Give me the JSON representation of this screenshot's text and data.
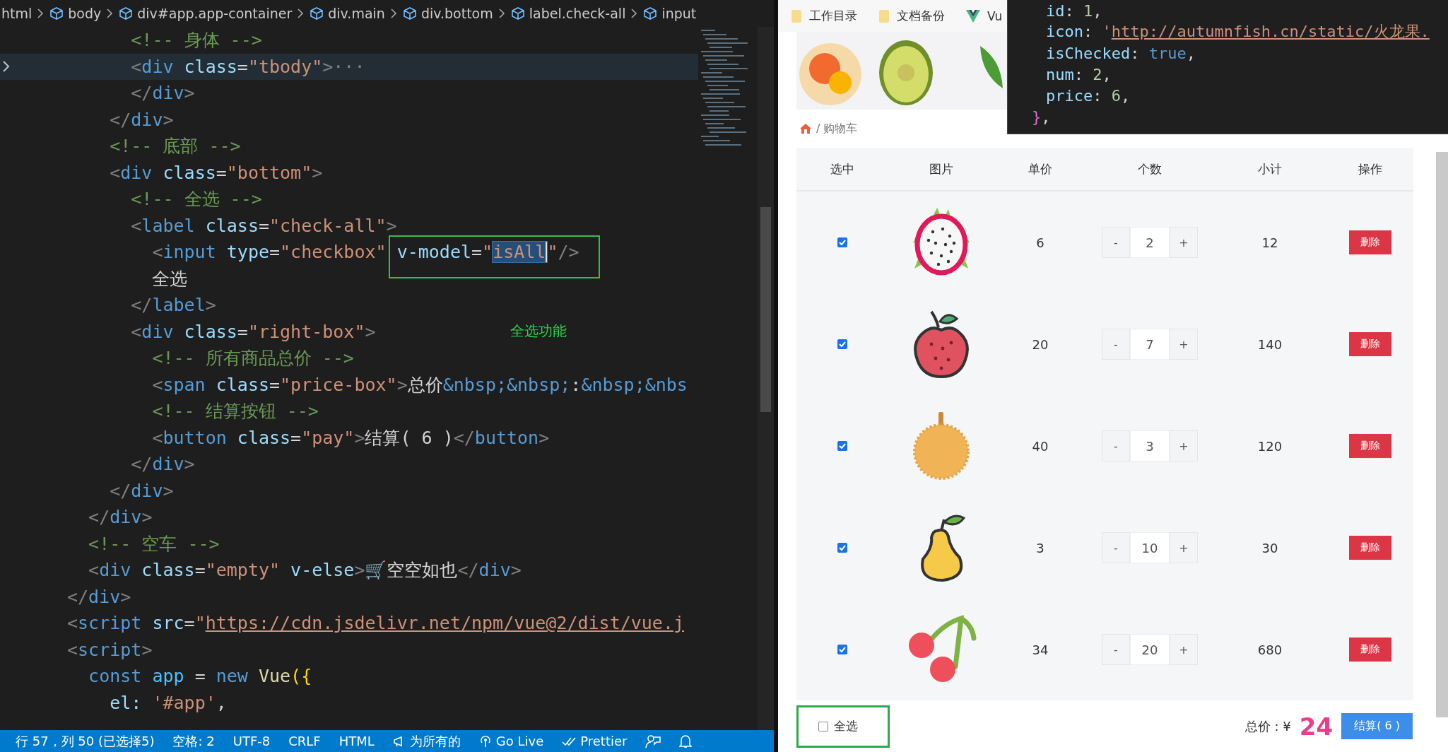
{
  "editor": {
    "breadcrumb": [
      "html",
      "body",
      "div#app.app-container",
      "div.main",
      "div.bottom",
      "label.check-all",
      "input"
    ],
    "lines": [
      {
        "folded": false,
        "tokens": [
          {
            "text": "      <!-- 身体 -->",
            "kind": "comment"
          }
        ]
      },
      {
        "folded": true,
        "tokens": [
          {
            "text": "      <",
            "kind": "punct"
          },
          {
            "text": "div",
            "kind": "tag"
          },
          {
            "text": " class",
            "kind": "attr"
          },
          {
            "text": "=",
            "kind": "plain"
          },
          {
            "text": "\"tbody\"",
            "kind": "string"
          },
          {
            "text": ">",
            "kind": "punct"
          },
          {
            "text": "···",
            "kind": "punct"
          }
        ]
      },
      {
        "folded": false,
        "tokens": [
          {
            "text": "      </",
            "kind": "punct"
          },
          {
            "text": "div",
            "kind": "tag"
          },
          {
            "text": ">",
            "kind": "punct"
          }
        ]
      },
      {
        "folded": false,
        "tokens": [
          {
            "text": "    </",
            "kind": "punct"
          },
          {
            "text": "div",
            "kind": "tag"
          },
          {
            "text": ">",
            "kind": "punct"
          }
        ]
      },
      {
        "folded": false,
        "tokens": [
          {
            "text": "    <!-- 底部 -->",
            "kind": "comment"
          }
        ]
      },
      {
        "folded": false,
        "tokens": [
          {
            "text": "    <",
            "kind": "punct"
          },
          {
            "text": "div",
            "kind": "tag"
          },
          {
            "text": " class",
            "kind": "attr"
          },
          {
            "text": "=",
            "kind": "plain"
          },
          {
            "text": "\"bottom\"",
            "kind": "string"
          },
          {
            "text": ">",
            "kind": "punct"
          }
        ]
      },
      {
        "folded": false,
        "tokens": [
          {
            "text": "      <!-- 全选 -->",
            "kind": "comment"
          }
        ]
      },
      {
        "folded": false,
        "tokens": [
          {
            "text": "      <",
            "kind": "punct"
          },
          {
            "text": "label",
            "kind": "tag"
          },
          {
            "text": " class",
            "kind": "attr"
          },
          {
            "text": "=",
            "kind": "plain"
          },
          {
            "text": "\"check-all\"",
            "kind": "string"
          },
          {
            "text": ">",
            "kind": "punct"
          }
        ]
      },
      {
        "folded": false,
        "tokens": [
          {
            "text": "        <",
            "kind": "punct"
          },
          {
            "text": "input",
            "kind": "tag"
          },
          {
            "text": " type",
            "kind": "attr"
          },
          {
            "text": "=",
            "kind": "plain"
          },
          {
            "text": "\"checkbox\" ",
            "kind": "string"
          }
        ],
        "boxed": [
          {
            "text": "v-model",
            "kind": "attr"
          },
          {
            "text": "=",
            "kind": "plain"
          },
          {
            "text": "\"",
            "kind": "string"
          },
          {
            "text": "isAll",
            "kind": "selection"
          },
          {
            "text": "\"",
            "kind": "string"
          },
          {
            "text": "/>",
            "kind": "punct"
          }
        ]
      },
      {
        "folded": false,
        "tokens": [
          {
            "text": "        全选",
            "kind": "plain"
          }
        ]
      },
      {
        "folded": false,
        "tokens": [
          {
            "text": "      </",
            "kind": "punct"
          },
          {
            "text": "label",
            "kind": "tag"
          },
          {
            "text": ">",
            "kind": "punct"
          }
        ]
      },
      {
        "folded": false,
        "note": "全选功能",
        "tokens": [
          {
            "text": "      <",
            "kind": "punct"
          },
          {
            "text": "div",
            "kind": "tag"
          },
          {
            "text": " class",
            "kind": "attr"
          },
          {
            "text": "=",
            "kind": "plain"
          },
          {
            "text": "\"right-box\"",
            "kind": "string"
          },
          {
            "text": ">",
            "kind": "punct"
          }
        ]
      },
      {
        "folded": false,
        "tokens": [
          {
            "text": "        <!-- 所有商品总价 -->",
            "kind": "comment"
          }
        ]
      },
      {
        "folded": false,
        "tokens": [
          {
            "text": "        <",
            "kind": "punct"
          },
          {
            "text": "span",
            "kind": "tag"
          },
          {
            "text": " class",
            "kind": "attr"
          },
          {
            "text": "=",
            "kind": "plain"
          },
          {
            "text": "\"price-box\"",
            "kind": "string"
          },
          {
            "text": ">",
            "kind": "punct"
          },
          {
            "text": "总价",
            "kind": "plain"
          },
          {
            "text": "&nbsp;&nbsp;",
            "kind": "entity"
          },
          {
            "text": ":",
            "kind": "plain"
          },
          {
            "text": "&nbsp;&nbs",
            "kind": "entity"
          }
        ]
      },
      {
        "folded": false,
        "tokens": [
          {
            "text": "        <!-- 结算按钮 -->",
            "kind": "comment"
          }
        ]
      },
      {
        "folded": false,
        "tokens": [
          {
            "text": "        <",
            "kind": "punct"
          },
          {
            "text": "button",
            "kind": "tag"
          },
          {
            "text": " class",
            "kind": "attr"
          },
          {
            "text": "=",
            "kind": "plain"
          },
          {
            "text": "\"pay\"",
            "kind": "string"
          },
          {
            "text": ">",
            "kind": "punct"
          },
          {
            "text": "结算( 6 )",
            "kind": "plain"
          },
          {
            "text": "</",
            "kind": "punct"
          },
          {
            "text": "button",
            "kind": "tag"
          },
          {
            "text": ">",
            "kind": "punct"
          }
        ]
      },
      {
        "folded": false,
        "tokens": [
          {
            "text": "      </",
            "kind": "punct"
          },
          {
            "text": "div",
            "kind": "tag"
          },
          {
            "text": ">",
            "kind": "punct"
          }
        ]
      },
      {
        "folded": false,
        "tokens": [
          {
            "text": "    </",
            "kind": "punct"
          },
          {
            "text": "div",
            "kind": "tag"
          },
          {
            "text": ">",
            "kind": "punct"
          }
        ]
      },
      {
        "folded": false,
        "tokens": [
          {
            "text": "  </",
            "kind": "punct"
          },
          {
            "text": "div",
            "kind": "tag"
          },
          {
            "text": ">",
            "kind": "punct"
          }
        ]
      },
      {
        "folded": false,
        "tokens": [
          {
            "text": "  <!-- 空车 -->",
            "kind": "comment"
          }
        ]
      },
      {
        "folded": false,
        "tokens": [
          {
            "text": "  <",
            "kind": "punct"
          },
          {
            "text": "div",
            "kind": "tag"
          },
          {
            "text": " class",
            "kind": "attr"
          },
          {
            "text": "=",
            "kind": "plain"
          },
          {
            "text": "\"empty\"",
            "kind": "string"
          },
          {
            "text": " v-else",
            "kind": "attr"
          },
          {
            "text": ">",
            "kind": "punct"
          },
          {
            "text": "🛒空空如也",
            "kind": "plain"
          },
          {
            "text": "</",
            "kind": "punct"
          },
          {
            "text": "div",
            "kind": "tag"
          },
          {
            "text": ">",
            "kind": "punct"
          }
        ]
      },
      {
        "folded": false,
        "tokens": [
          {
            "text": "</",
            "kind": "punct"
          },
          {
            "text": "div",
            "kind": "tag"
          },
          {
            "text": ">",
            "kind": "punct"
          }
        ]
      },
      {
        "folded": false,
        "tokens": [
          {
            "text": "<",
            "kind": "punct"
          },
          {
            "text": "script",
            "kind": "tag"
          },
          {
            "text": " src",
            "kind": "attr"
          },
          {
            "text": "=",
            "kind": "plain"
          },
          {
            "text": "\"",
            "kind": "string"
          },
          {
            "text": "https://cdn.jsdelivr.net/npm/vue@2/dist/vue.j",
            "kind": "url"
          }
        ]
      },
      {
        "folded": false,
        "tokens": [
          {
            "text": "<",
            "kind": "punct"
          },
          {
            "text": "script",
            "kind": "tag"
          },
          {
            "text": ">",
            "kind": "punct"
          }
        ]
      },
      {
        "folded": false,
        "tokens": [
          {
            "text": "  const",
            "kind": "keyword"
          },
          {
            "text": " app",
            "kind": "variable"
          },
          {
            "text": " = ",
            "kind": "plain"
          },
          {
            "text": "new",
            "kind": "keyword"
          },
          {
            "text": " Vue",
            "kind": "class"
          },
          {
            "text": "({",
            "kind": "bracket"
          }
        ]
      },
      {
        "folded": false,
        "tokens": [
          {
            "text": "    el: ",
            "kind": "attr"
          },
          {
            "text": "'#app'",
            "kind": "string"
          },
          {
            "text": ",",
            "kind": "plain"
          }
        ]
      }
    ]
  },
  "status_bar": {
    "items": [
      {
        "kind": "text",
        "text": "行 57，列 50 (已选择5)"
      },
      {
        "kind": "text",
        "text": "空格: 2"
      },
      {
        "kind": "text",
        "text": "UTF-8"
      },
      {
        "kind": "text",
        "text": "CRLF"
      },
      {
        "kind": "text",
        "text": "HTML"
      },
      {
        "kind": "share",
        "text": "为所有的"
      },
      {
        "kind": "golive",
        "text": "Go Live"
      },
      {
        "kind": "prettier",
        "text": "Prettier"
      },
      {
        "kind": "feedback"
      },
      {
        "kind": "bell"
      }
    ]
  },
  "browser": {
    "bookmarks": [
      {
        "kind": "folder",
        "label": "工作目录"
      },
      {
        "kind": "folder",
        "label": "文档备份"
      },
      {
        "kind": "vue",
        "label": "Vu"
      }
    ],
    "hover_popup": {
      "lines": [
        [
          {
            "text": "id",
            "kind": "attr"
          },
          {
            "text": ": ",
            "kind": "plain"
          },
          {
            "text": "1",
            "kind": "number"
          },
          {
            "text": ",",
            "kind": "plain"
          }
        ],
        [
          {
            "text": "icon",
            "kind": "attr"
          },
          {
            "text": ": ",
            "kind": "plain"
          },
          {
            "text": "'",
            "kind": "string"
          },
          {
            "text": "http://autumnfish.cn/static/火龙果.",
            "kind": "url"
          }
        ],
        [
          {
            "text": "isChecked",
            "kind": "attr"
          },
          {
            "text": ": ",
            "kind": "plain"
          },
          {
            "text": "true",
            "kind": "keyword"
          },
          {
            "text": ",",
            "kind": "plain"
          }
        ],
        [
          {
            "text": "num",
            "kind": "attr"
          },
          {
            "text": ": ",
            "kind": "plain"
          },
          {
            "text": "2",
            "kind": "number"
          },
          {
            "text": ",",
            "kind": "plain"
          }
        ],
        [
          {
            "text": "price",
            "kind": "attr"
          },
          {
            "text": ": ",
            "kind": "plain"
          },
          {
            "text": "6",
            "kind": "number"
          },
          {
            "text": ",",
            "kind": "plain"
          }
        ],
        [
          {
            "text": "}",
            "kind": "brace"
          },
          {
            "text": ",",
            "kind": "plain"
          }
        ]
      ]
    },
    "breadcrumb": "/ 购物车",
    "table": {
      "columns": [
        "选中",
        "图片",
        "单价",
        "个数",
        "小计",
        "操作"
      ],
      "rows": [
        {
          "checked": true,
          "kind": "dragonfruit",
          "price": "6",
          "minus": "-",
          "num": "2",
          "plus": "+",
          "subtotal": "12",
          "action": "删除"
        },
        {
          "checked": true,
          "kind": "lychee",
          "price": "20",
          "minus": "-",
          "num": "7",
          "plus": "+",
          "subtotal": "140",
          "action": "删除"
        },
        {
          "checked": true,
          "kind": "durian",
          "price": "40",
          "minus": "-",
          "num": "3",
          "plus": "+",
          "subtotal": "120",
          "action": "删除"
        },
        {
          "checked": true,
          "kind": "pear",
          "price": "3",
          "minus": "-",
          "num": "10",
          "plus": "+",
          "subtotal": "30",
          "action": "删除"
        },
        {
          "checked": true,
          "kind": "cherry",
          "price": "34",
          "minus": "-",
          "num": "20",
          "plus": "+",
          "subtotal": "680",
          "action": "删除"
        }
      ]
    },
    "footer": {
      "select_all": {
        "label": "全选",
        "checked": false
      },
      "total_label": "总价 : ¥",
      "total": "24",
      "pay": "结算( 6 )"
    }
  }
}
